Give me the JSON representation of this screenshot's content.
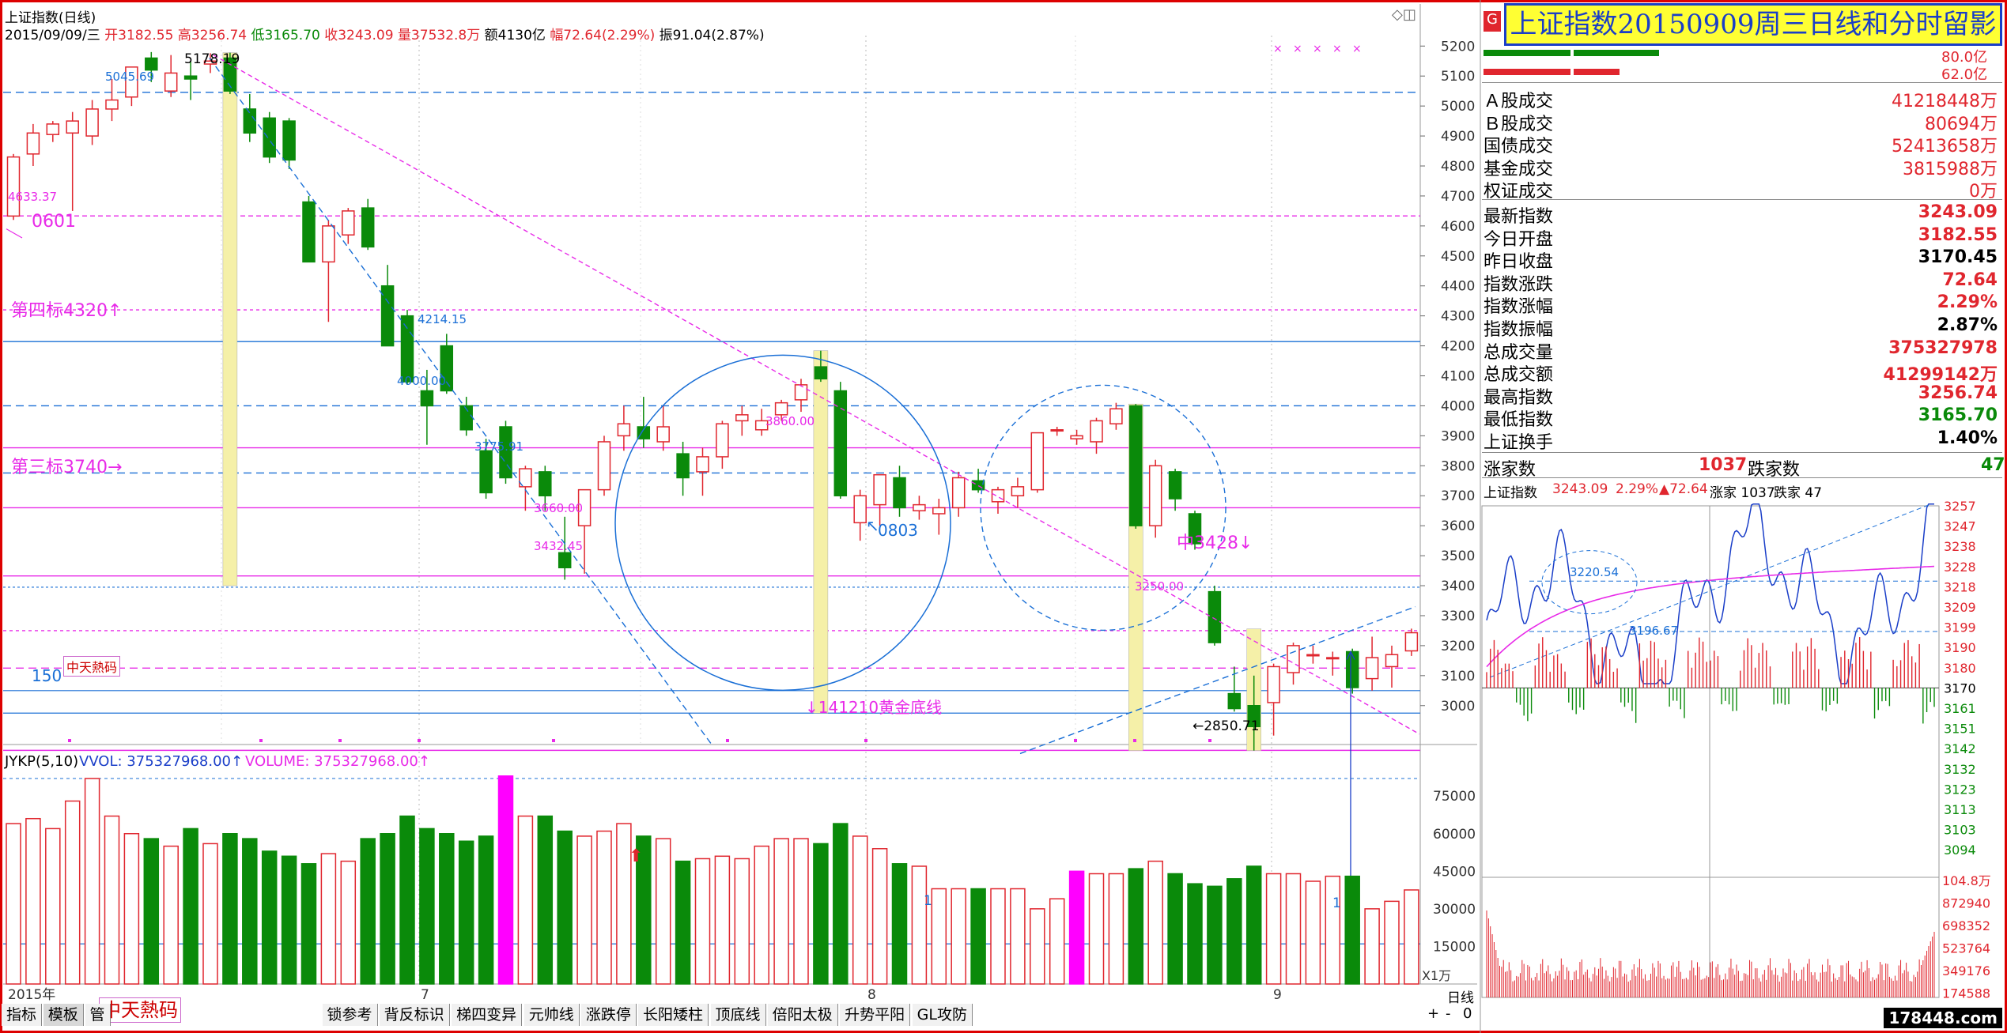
{
  "header": {
    "name": "上证指数(日线)",
    "line": [
      {
        "text": "2015/09/09/三",
        "color": "#000000"
      },
      {
        "text": "开3182.55",
        "color": "#e0262e"
      },
      {
        "text": "高3256.74",
        "color": "#e0262e"
      },
      {
        "text": "低3165.70",
        "color": "#0a8a0a"
      },
      {
        "text": "收3243.09",
        "color": "#e0262e"
      },
      {
        "text": "量37532.8万",
        "color": "#e0262e"
      },
      {
        "text": "额4130亿",
        "color": "#000000"
      },
      {
        "text": "幅72.64(2.29%)",
        "color": "#e0262e"
      },
      {
        "text": "振91.04(2.87%)",
        "color": "#000000"
      }
    ]
  },
  "title_banner": "上证指数20150909周三日线和分时留影",
  "right_panel": {
    "bar_values": [
      "80.0亿",
      "62.0亿"
    ],
    "trade_rows": [
      {
        "k": "Ａ股成交",
        "v": "41218448万"
      },
      {
        "k": "Ｂ股成交",
        "v": "80694万"
      },
      {
        "k": "国债成交",
        "v": "52413658万"
      },
      {
        "k": "基金成交",
        "v": "3815988万"
      },
      {
        "k": "权证成交",
        "v": "0万"
      }
    ],
    "index_rows": [
      {
        "k": "最新指数",
        "v": "3243.09",
        "c": "#e0262e"
      },
      {
        "k": "今日开盘",
        "v": "3182.55",
        "c": "#e0262e"
      },
      {
        "k": "昨日收盘",
        "v": "3170.45",
        "c": "#000000"
      },
      {
        "k": "指数涨跌",
        "v": "72.64",
        "c": "#e0262e"
      },
      {
        "k": "指数涨幅",
        "v": "2.29%",
        "c": "#e0262e"
      },
      {
        "k": "指数振幅",
        "v": "2.87%",
        "c": "#000000"
      },
      {
        "k": "总成交量",
        "v": "375327978",
        "c": "#e0262e"
      },
      {
        "k": "总成交额",
        "v": "41299142万",
        "c": "#e0262e"
      },
      {
        "k": "最高指数",
        "v": "3256.74",
        "c": "#e0262e"
      },
      {
        "k": "最低指数",
        "v": "3165.70",
        "c": "#0a8a0a"
      },
      {
        "k": "上证换手",
        "v": "1.40%",
        "c": "#000000"
      }
    ],
    "breadth": {
      "up_label": "涨家数",
      "up": "1037",
      "down_label": "跌家数",
      "down": "47"
    },
    "mini_header": {
      "name": "上证指数",
      "price": "3243.09",
      "pct": "2.29%",
      "chg": "▲72.64",
      "up": "涨家 1037",
      "down": "跌家 47"
    },
    "mini_price_ticks": [
      "3257",
      "3247",
      "3238",
      "3228",
      "3218",
      "3209",
      "3199",
      "3190",
      "3180",
      "3170",
      "3161",
      "3151",
      "3142",
      "3132",
      "3123",
      "3113",
      "3103",
      "3094"
    ],
    "mini_vol_ticks": [
      "104.8万",
      "872940",
      "698352",
      "523764",
      "349176",
      "174588"
    ],
    "mini_labels": [
      "3220.54",
      "3196.67"
    ]
  },
  "axis": {
    "price_ticks": [
      "5200",
      "5100",
      "5000",
      "4900",
      "4800",
      "4700",
      "4600",
      "4500",
      "4400",
      "4300",
      "4200",
      "4100",
      "4000",
      "3900",
      "3800",
      "3700",
      "3600",
      "3500",
      "3400",
      "3300",
      "3200",
      "3100",
      "3000"
    ],
    "vol_ticks": [
      "75000",
      "60000",
      "45000",
      "30000",
      "15000"
    ],
    "vol_unit": "X1万",
    "x_labels": [
      "2015年",
      "7",
      "8",
      "9"
    ]
  },
  "indicator_header": {
    "name": "JYKP(5,10)",
    "vvol": "VVOL: 375327968.00↑",
    "volume": "VOLUME: 375327968.00↑"
  },
  "annotations": {
    "high": "5178.19",
    "p4633": "4633.37",
    "d0601": "0601",
    "target4": "第四标4320↑",
    "target3": "第三标3740→",
    "p5045": "5045.69",
    "p4214": "4214.15",
    "p4000": "4000.00",
    "p3775": "3775.91",
    "p3660": "3660.00",
    "p3432": "3432.45",
    "p3860": "3860.00",
    "d0803": "0803",
    "mid": "中3428↓",
    "p3250": "3250.00",
    "low": "←2850.71",
    "gold": "↓141210黄金底线",
    "p150": "150",
    "vol_note1": "1",
    "vol_note2": "1"
  },
  "tabs": [
    "指标",
    "模板",
    "管",
    "锁参考",
    "背反标识",
    "梯四变异",
    "元帅线",
    "涨跌停",
    "长阳矮柱",
    "顶底线",
    "倍阳太极",
    "升势平阳",
    "GL攻防"
  ],
  "bottom_right": [
    "日线",
    "+",
    "-",
    "0"
  ],
  "logo_text": "中天熱码",
  "watermark": "178448.com",
  "colors": {
    "up": "#e0262e",
    "down": "#0a8a0a",
    "volume_special": "#ff00ff",
    "accent": "#1a6fd6",
    "magenta": "#e82ae8",
    "highlight": "#f5f0a8"
  },
  "chart_data": {
    "type": "candlestick",
    "title": "上证指数(日线)",
    "period": "2015/06 - 2015/09/09",
    "ylim": [
      2800,
      5250
    ],
    "candles": [
      {
        "o": 4633,
        "h": 4840,
        "l": 4620,
        "c": 4830
      },
      {
        "o": 4840,
        "h": 4940,
        "l": 4800,
        "c": 4910
      },
      {
        "o": 4905,
        "h": 4950,
        "l": 4880,
        "c": 4940
      },
      {
        "o": 4910,
        "h": 4980,
        "l": 4650,
        "c": 4950
      },
      {
        "o": 4900,
        "h": 5020,
        "l": 4870,
        "c": 4990
      },
      {
        "o": 4990,
        "h": 5090,
        "l": 4950,
        "c": 5020
      },
      {
        "o": 5030,
        "h": 5130,
        "l": 5000,
        "c": 5130
      },
      {
        "o": 5160,
        "h": 5180,
        "l": 5080,
        "c": 5120
      },
      {
        "o": 5050,
        "h": 5170,
        "l": 5030,
        "c": 5110
      },
      {
        "o": 5100,
        "h": 5150,
        "l": 5020,
        "c": 5090
      },
      {
        "o": 5140,
        "h": 5176,
        "l": 5110,
        "c": 5150
      },
      {
        "o": 5160,
        "h": 5178,
        "l": 5040,
        "c": 5050
      },
      {
        "o": 4990,
        "h": 5040,
        "l": 4880,
        "c": 4910
      },
      {
        "o": 4960,
        "h": 4980,
        "l": 4810,
        "c": 4830
      },
      {
        "o": 4950,
        "h": 4960,
        "l": 4790,
        "c": 4820
      },
      {
        "o": 4680,
        "h": 4700,
        "l": 4480,
        "c": 4480
      },
      {
        "o": 4480,
        "h": 4620,
        "l": 4280,
        "c": 4600
      },
      {
        "o": 4570,
        "h": 4660,
        "l": 4540,
        "c": 4650
      },
      {
        "o": 4660,
        "h": 4690,
        "l": 4520,
        "c": 4530
      },
      {
        "o": 4400,
        "h": 4470,
        "l": 4200,
        "c": 4200
      },
      {
        "o": 4300,
        "h": 4320,
        "l": 4070,
        "c": 4080
      },
      {
        "o": 4050,
        "h": 4120,
        "l": 3870,
        "c": 4000
      },
      {
        "o": 4200,
        "h": 4240,
        "l": 4040,
        "c": 4050
      },
      {
        "o": 4000,
        "h": 4030,
        "l": 3900,
        "c": 3920
      },
      {
        "o": 3850,
        "h": 3890,
        "l": 3690,
        "c": 3710
      },
      {
        "o": 3930,
        "h": 3950,
        "l": 3740,
        "c": 3760
      },
      {
        "o": 3730,
        "h": 3800,
        "l": 3650,
        "c": 3790
      },
      {
        "o": 3780,
        "h": 3800,
        "l": 3650,
        "c": 3700
      },
      {
        "o": 3510,
        "h": 3630,
        "l": 3420,
        "c": 3460
      },
      {
        "o": 3600,
        "h": 3700,
        "l": 3440,
        "c": 3720
      },
      {
        "o": 3720,
        "h": 3900,
        "l": 3700,
        "c": 3880
      },
      {
        "o": 3900,
        "h": 4000,
        "l": 3850,
        "c": 3940
      },
      {
        "o": 3930,
        "h": 4030,
        "l": 3860,
        "c": 3890
      },
      {
        "o": 3880,
        "h": 4000,
        "l": 3850,
        "c": 3930
      },
      {
        "o": 3840,
        "h": 3880,
        "l": 3700,
        "c": 3760
      },
      {
        "o": 3780,
        "h": 3860,
        "l": 3700,
        "c": 3830
      },
      {
        "o": 3830,
        "h": 3950,
        "l": 3790,
        "c": 3940
      },
      {
        "o": 3950,
        "h": 4000,
        "l": 3900,
        "c": 3970
      },
      {
        "o": 3920,
        "h": 3990,
        "l": 3900,
        "c": 3950
      },
      {
        "o": 3970,
        "h": 4020,
        "l": 3950,
        "c": 4010
      },
      {
        "o": 4020,
        "h": 4090,
        "l": 3980,
        "c": 4070
      },
      {
        "o": 4130,
        "h": 4184,
        "l": 4080,
        "c": 4090
      },
      {
        "o": 4050,
        "h": 4080,
        "l": 3690,
        "c": 3700
      },
      {
        "o": 3610,
        "h": 3720,
        "l": 3550,
        "c": 3700
      },
      {
        "o": 3670,
        "h": 3770,
        "l": 3600,
        "c": 3770
      },
      {
        "o": 3760,
        "h": 3800,
        "l": 3630,
        "c": 3660
      },
      {
        "o": 3650,
        "h": 3700,
        "l": 3620,
        "c": 3670
      },
      {
        "o": 3640,
        "h": 3690,
        "l": 3570,
        "c": 3660
      },
      {
        "o": 3660,
        "h": 3780,
        "l": 3630,
        "c": 3760
      },
      {
        "o": 3750,
        "h": 3790,
        "l": 3710,
        "c": 3720
      },
      {
        "o": 3680,
        "h": 3730,
        "l": 3640,
        "c": 3720
      },
      {
        "o": 3700,
        "h": 3760,
        "l": 3660,
        "c": 3730
      },
      {
        "o": 3720,
        "h": 3900,
        "l": 3710,
        "c": 3910
      },
      {
        "o": 3920,
        "h": 3930,
        "l": 3900,
        "c": 3920
      },
      {
        "o": 3890,
        "h": 3920,
        "l": 3870,
        "c": 3900
      },
      {
        "o": 3880,
        "h": 3960,
        "l": 3840,
        "c": 3950
      },
      {
        "o": 3940,
        "h": 4010,
        "l": 3920,
        "c": 3990
      },
      {
        "o": 4000,
        "h": 4006,
        "l": 3590,
        "c": 3600
      },
      {
        "o": 3600,
        "h": 3820,
        "l": 3560,
        "c": 3800
      },
      {
        "o": 3780,
        "h": 3790,
        "l": 3650,
        "c": 3690
      },
      {
        "o": 3640,
        "h": 3650,
        "l": 3520,
        "c": 3540
      },
      {
        "o": 3380,
        "h": 3400,
        "l": 3200,
        "c": 3210
      },
      {
        "o": 3040,
        "h": 3130,
        "l": 2980,
        "c": 2990
      },
      {
        "o": 3000,
        "h": 3100,
        "l": 2850,
        "c": 2930
      },
      {
        "o": 3010,
        "h": 3140,
        "l": 2900,
        "c": 3130
      },
      {
        "o": 3110,
        "h": 3210,
        "l": 3070,
        "c": 3200
      },
      {
        "o": 3170,
        "h": 3200,
        "l": 3140,
        "c": 3170
      },
      {
        "o": 3160,
        "h": 3180,
        "l": 3100,
        "c": 3160
      },
      {
        "o": 3180,
        "h": 3190,
        "l": 3040,
        "c": 3060
      },
      {
        "o": 3090,
        "h": 3230,
        "l": 3050,
        "c": 3160
      },
      {
        "o": 3130,
        "h": 3200,
        "l": 3060,
        "c": 3170
      },
      {
        "o": 3182.55,
        "h": 3256.74,
        "l": 3165.7,
        "c": 3243.09
      }
    ],
    "volume": {
      "unit": "万手",
      "values": [
        64000,
        66000,
        62000,
        73000,
        82000,
        67000,
        60000,
        58000,
        55000,
        62000,
        56000,
        60000,
        58000,
        53000,
        51000,
        48000,
        52000,
        49000,
        58000,
        60000,
        67000,
        62000,
        60000,
        57000,
        59000,
        83000,
        67000,
        67000,
        61000,
        59000,
        61000,
        64000,
        59000,
        58000,
        49000,
        50000,
        51000,
        50000,
        55000,
        58000,
        58000,
        56000,
        64000,
        59000,
        54000,
        48000,
        47000,
        38000,
        38000,
        38000,
        38000,
        38000,
        30000,
        34000,
        45000,
        44000,
        44000,
        46000,
        49000,
        44000,
        40000,
        39000,
        42000,
        47000,
        44000,
        44000,
        41000,
        43000,
        43000,
        30000,
        33000,
        37532.8
      ],
      "special_index": [
        25,
        54
      ],
      "vvol": "375327968.00"
    },
    "reference_lines": [
      5045.69,
      4633.37,
      4320,
      4214.15,
      4000,
      3860,
      3775.91,
      3660,
      3432.45,
      3250,
      2850.71
    ]
  }
}
